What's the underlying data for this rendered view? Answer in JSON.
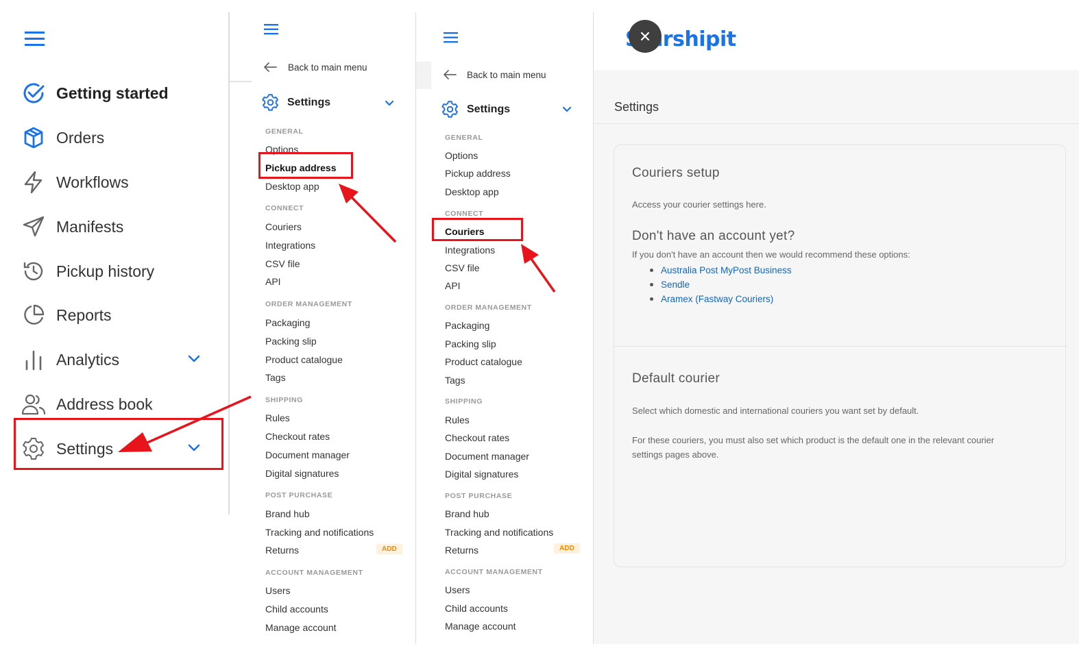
{
  "panel1": {
    "menu_icon": "hamburger-icon",
    "items": [
      {
        "label": "Getting started",
        "icon": "check-circle-icon"
      },
      {
        "label": "Orders",
        "icon": "box-icon"
      },
      {
        "label": "Workflows",
        "icon": "lightning-icon"
      },
      {
        "label": "Manifests",
        "icon": "send-icon"
      },
      {
        "label": "Pickup history",
        "icon": "history-icon"
      },
      {
        "label": "Reports",
        "icon": "pie-chart-icon"
      },
      {
        "label": "Analytics",
        "icon": "bar-chart-icon"
      },
      {
        "label": "Address book",
        "icon": "users-icon"
      },
      {
        "label": "Settings",
        "icon": "gear-icon"
      }
    ]
  },
  "panel2": {
    "back_label": "Back to main menu",
    "settings_label": "Settings",
    "sections": {
      "general": "GENERAL",
      "connect": "CONNECT",
      "order_management": "ORDER MANAGEMENT",
      "shipping": "SHIPPING",
      "post_purchase": "POST PURCHASE",
      "account_management": "ACCOUNT MANAGEMENT"
    },
    "links": {
      "options": "Options",
      "pickup_address": "Pickup address",
      "desktop_app": "Desktop app",
      "couriers": "Couriers",
      "integrations": "Integrations",
      "csv_file": "CSV file",
      "api": "API",
      "packaging": "Packaging",
      "packing_slip": "Packing slip",
      "product_catalogue": "Product catalogue",
      "tags": "Tags",
      "rules": "Rules",
      "checkout_rates": "Checkout rates",
      "document_manager": "Document manager",
      "digital_signatures": "Digital signatures",
      "brand_hub": "Brand hub",
      "tracking": "Tracking and notifications",
      "returns": "Returns",
      "users": "Users",
      "child_accounts": "Child accounts",
      "manage_account": "Manage account"
    },
    "add_badge": "ADD"
  },
  "panel3": {
    "back_label": "Back to main menu",
    "settings_label": "Settings",
    "sections": {
      "general": "GENERAL",
      "connect": "CONNECT",
      "order_management": "ORDER MANAGEMENT",
      "shipping": "SHIPPING",
      "post_purchase": "POST PURCHASE",
      "account_management": "ACCOUNT MANAGEMENT"
    },
    "links": {
      "options": "Options",
      "pickup_address": "Pickup address",
      "desktop_app": "Desktop app",
      "couriers": "Couriers",
      "integrations": "Integrations",
      "csv_file": "CSV file",
      "api": "API",
      "packaging": "Packaging",
      "packing_slip": "Packing slip",
      "product_catalogue": "Product catalogue",
      "tags": "Tags",
      "rules": "Rules",
      "checkout_rates": "Checkout rates",
      "document_manager": "Document manager",
      "digital_signatures": "Digital signatures",
      "brand_hub": "Brand hub",
      "tracking": "Tracking and notifications",
      "returns": "Returns",
      "users": "Users",
      "child_accounts": "Child accounts",
      "manage_account": "Manage account"
    },
    "add_badge": "ADD"
  },
  "main": {
    "logo_text": "Starshipit",
    "close_icon": "close-icon",
    "page_title": "Settings",
    "couriers_setup": {
      "title": "Couriers setup",
      "desc": "Access your courier settings here.",
      "no_account_title": "Don't have an account yet?",
      "no_account_desc": "If you don't have an account then we would recommend these options:",
      "options": [
        "Australia Post MyPost Business",
        "Sendle",
        "Aramex (Fastway Couriers)"
      ]
    },
    "default_courier": {
      "title": "Default courier",
      "desc1": "Select which domestic and international couriers you want set by default.",
      "desc2a": "For these couriers, you must also set which product is the default one in the relevant courier",
      "desc2b": "settings pages above."
    }
  },
  "colors": {
    "brand_blue": "#1a73e8",
    "link_blue": "#1565c0",
    "highlight_red": "#e8141c",
    "badge_orange": "#f08c00"
  }
}
